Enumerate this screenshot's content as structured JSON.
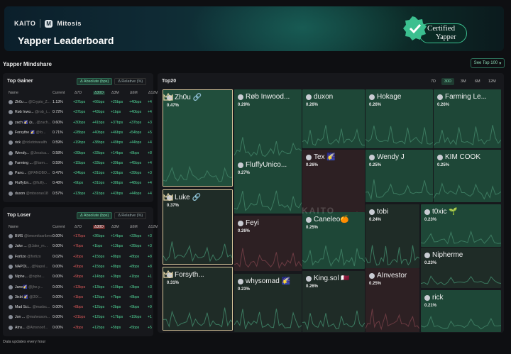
{
  "banner": {
    "brand1": "KAITO",
    "brand2": "Mitosis",
    "title": "Yapper Leaderboard",
    "cert1": "Certified",
    "cert2": "Yapper"
  },
  "mindshare": {
    "title": "Yapper Mindshare",
    "see_top": "See Top 100"
  },
  "gainer": {
    "title": "Top Gainer",
    "toggle_abs": "Δ Absolute (bps)",
    "toggle_rel": "Δ Relative (%)",
    "cols": [
      "Name",
      "Current",
      "Δ7D",
      "Δ30D",
      "Δ3M",
      "Δ6M",
      "Δ12M"
    ],
    "rows": [
      [
        "Zh0u ...",
        "@Crypto_Z...",
        "1.13%",
        "+37bps",
        "+66bps",
        "+25bps",
        "+40bps",
        "+4"
      ],
      [
        "Røb Inwo...",
        "@rob_i...",
        "0.72%",
        "+37bps",
        "+43bps",
        "+1bps",
        "+40bps",
        "+4"
      ],
      [
        "zach 🌠 (s...",
        "@zach...",
        "0.60%",
        "+30bps",
        "+41bps",
        "+37bps",
        "+37bps",
        "+3"
      ],
      [
        "Forsythe 🌠",
        "@fo...",
        "0.71%",
        "+28bps",
        "+40bps",
        "+46bps",
        "+54bps",
        "+5"
      ],
      [
        "rick",
        "@rickdotwealth",
        "0.59%",
        "+19bps",
        "+38bps",
        "+49bps",
        "+44bps",
        "+4"
      ],
      [
        "Wendy...",
        "@Jessica...",
        "0.58%",
        "+39bps",
        "+33bps",
        "+14bps",
        "+8bps",
        "+8"
      ],
      [
        "Farming ...",
        "@farm...",
        "0.59%",
        "+15bps",
        "+33bps",
        "+39bps",
        "+45bps",
        "+4"
      ],
      [
        "Pano...",
        "@PANOBO...",
        "0.47%",
        "+24bps",
        "+31bps",
        "+33bps",
        "+39bps",
        "+3"
      ],
      [
        "FluffyUn...",
        "@fluffy...",
        "0.48%",
        "+9bps",
        "+31bps",
        "+38bps",
        "+48bps",
        "+4"
      ],
      [
        "duxon",
        "@mbsorao18",
        "0.57%",
        "+13bps",
        "+31bps",
        "+43bps",
        "+44bps",
        "+4"
      ]
    ]
  },
  "loser": {
    "title": "Top Loser",
    "toggle_abs": "Δ Absolute (bps)",
    "toggle_rel": "Δ Relative (%)",
    "cols": [
      "Name",
      "Current",
      "Δ7D",
      "Δ30D",
      "Δ3M",
      "Δ6M",
      "Δ12M"
    ],
    "rows": [
      [
        "BMS",
        "@bmsmitsaribms",
        "0.00%",
        "+17bps",
        "+36bps",
        "+14bps",
        "+33bps",
        "+3"
      ],
      [
        "Jake ...",
        "@Jake_m...",
        "0.00%",
        "+7bps",
        "+1bps",
        "+13bps",
        "+35bps",
        "+3"
      ],
      [
        "Fortizo",
        "@fortizo",
        "0.02%",
        "+2bps",
        "+15bps",
        "+8bps",
        "+8bps",
        "+8"
      ],
      [
        "NAPOL...",
        "@Napol...",
        "0.00%",
        "+0bps",
        "+15bps",
        "+8bps",
        "+8bps",
        "+8"
      ],
      [
        "Niphe...",
        "@niphe...",
        "0.00%",
        "+9bps",
        "+14bps",
        "+3bps",
        "+1bps",
        "+1"
      ],
      [
        "Jane🌠",
        "@jhe.y...",
        "0.00%",
        "+13bps",
        "+13bps",
        "+10bps",
        "+3bps",
        "+3"
      ],
      [
        "3ixbt 🌠",
        "@3IX...",
        "0.00%",
        "+1bps",
        "+12bps",
        "+7bps",
        "+8bps",
        "+8"
      ],
      [
        "Mad Sci...",
        "@madsc...",
        "0.00%",
        "+8bps",
        "+12bps",
        "+2bps",
        "+9bps",
        "+9"
      ],
      [
        "Jon ...",
        "@mahesson...",
        "0.00%",
        "+21bps",
        "+12bps",
        "+17bps",
        "+19bps",
        "+1"
      ],
      [
        "Atns...",
        "@Atnsnoof...",
        "0.00%",
        "+3bps",
        "+12bps",
        "+5bps",
        "+5bps",
        "+5"
      ]
    ]
  },
  "top20": {
    "title": "Top20",
    "periods": [
      "7D",
      "30D",
      "3M",
      "6M",
      "12M"
    ],
    "active": "30D",
    "tiles": [
      {
        "name": "Zh0u 🔗",
        "value": "0.47%"
      },
      {
        "name": "Luke 🔗",
        "value": "0.37%"
      },
      {
        "name": "Forsyth...",
        "value": "0.31%"
      },
      {
        "name": "Røb Inwood...",
        "value": "0.29%"
      },
      {
        "name": "duxon",
        "value": "0.26%"
      },
      {
        "name": "Hokage",
        "value": "0.26%"
      },
      {
        "name": "Farming Le...",
        "value": "0.26%"
      },
      {
        "name": "FluffyUnico...",
        "value": "0.27%"
      },
      {
        "name": "Tex 🌠",
        "value": "0.26%"
      },
      {
        "name": "Wendy J",
        "value": "0.25%"
      },
      {
        "name": "KIM COOK",
        "value": "0.25%"
      },
      {
        "name": "Feyi",
        "value": "0.26%"
      },
      {
        "name": "Caneleo🍊",
        "value": "0.25%"
      },
      {
        "name": "tobi",
        "value": "0.24%"
      },
      {
        "name": "t0xic 🌱",
        "value": "0.23%"
      },
      {
        "name": "whysomad 🌠",
        "value": "0.23%"
      },
      {
        "name": "King.sol 🇶🇦",
        "value": "0.26%"
      },
      {
        "name": "AInvestor",
        "value": "0.25%"
      },
      {
        "name": "Nipherme",
        "value": "0.23%"
      },
      {
        "name": "rick",
        "value": "0.21%"
      }
    ]
  },
  "watermark": "KAITO",
  "footer": "Data updates every hour"
}
